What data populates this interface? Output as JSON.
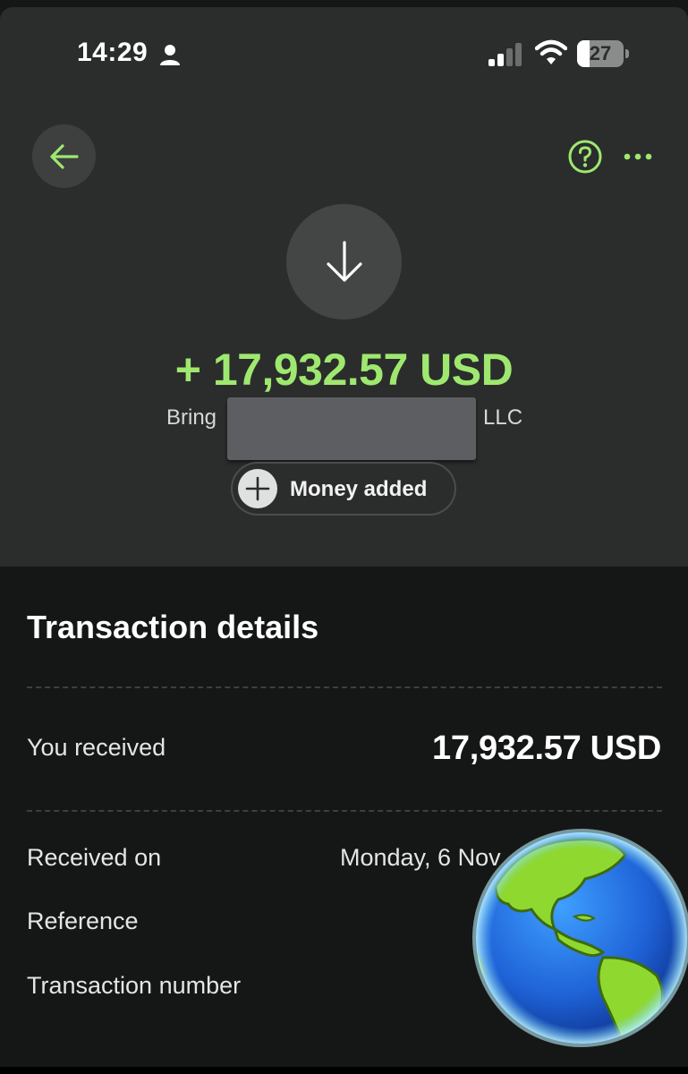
{
  "status_bar": {
    "time": "14:29",
    "battery_level": 27,
    "battery_text": "27",
    "icons": [
      "person-icon",
      "signal-icon",
      "wifi-icon",
      "battery-icon"
    ]
  },
  "header": {
    "back_icon": "arrow-left-icon",
    "help_icon": "question-circle-icon",
    "more_icon": "ellipsis-icon"
  },
  "transaction": {
    "direction_icon": "arrow-down-icon",
    "amount": "+ 17,932.57 USD",
    "sender_first": "Bring",
    "sender_last": "LLC",
    "status_icon": "plus-icon",
    "status_label": "Money added"
  },
  "details": {
    "title": "Transaction details",
    "received_label": "You received",
    "received_value": "17,932.57 USD",
    "received_on_label": "Received on",
    "received_on_value": "Monday, 6 Nov",
    "reference_label": "Reference",
    "transaction_number_label": "Transaction number"
  },
  "colors": {
    "accent_green": "#9fe870",
    "panel_bg": "#2b2d2c",
    "page_bg": "#151716"
  }
}
